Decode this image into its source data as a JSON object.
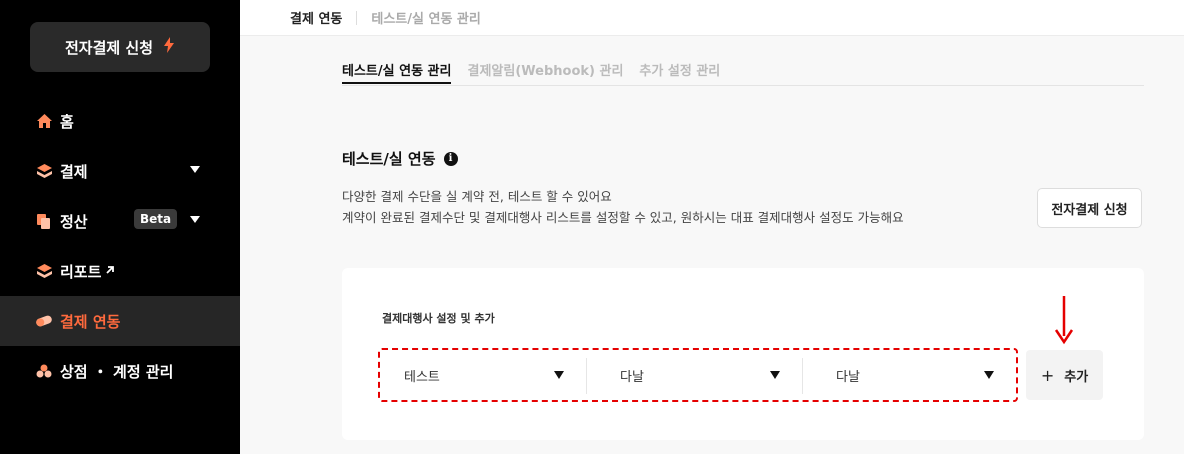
{
  "sidebar": {
    "apply_button": "전자결제 신청",
    "items": [
      {
        "label": "홈"
      },
      {
        "label": "결제"
      },
      {
        "label": "정산",
        "badge": "Beta"
      },
      {
        "label": "리포트"
      },
      {
        "label": "결제 연동"
      },
      {
        "label": "상점 ・ 계정 관리"
      }
    ]
  },
  "header": {
    "breadcrumb_1": "결제 연동",
    "breadcrumb_2": "테스트/실 연동 관리"
  },
  "tabs": [
    {
      "label": "테스트/실 연동 관리"
    },
    {
      "label": "결제알림(Webhook) 관리"
    },
    {
      "label": "추가 설정 관리"
    }
  ],
  "section": {
    "title": "테스트/실 연동",
    "info_glyph": "i",
    "desc_line1": "다양한 결제 수단을 실 계약 전, 테스트 할 수 있어요",
    "desc_line2": "계약이 완료된 결제수단 및 결제대행사 리스트를 설정할 수 있고, 원하시는 대표 결제대행사 설정도 가능해요",
    "apply_button": "전자결제 신청"
  },
  "pg_card": {
    "label": "결제대행사 설정 및 추가",
    "selects": [
      {
        "value": "테스트"
      },
      {
        "value": "다날"
      },
      {
        "value": "다날"
      }
    ],
    "add_button": "추가",
    "add_glyph": "+"
  },
  "colors": {
    "accent": "#ff6a3d",
    "highlight": "#e50000",
    "sidebar_bg": "#000000"
  }
}
